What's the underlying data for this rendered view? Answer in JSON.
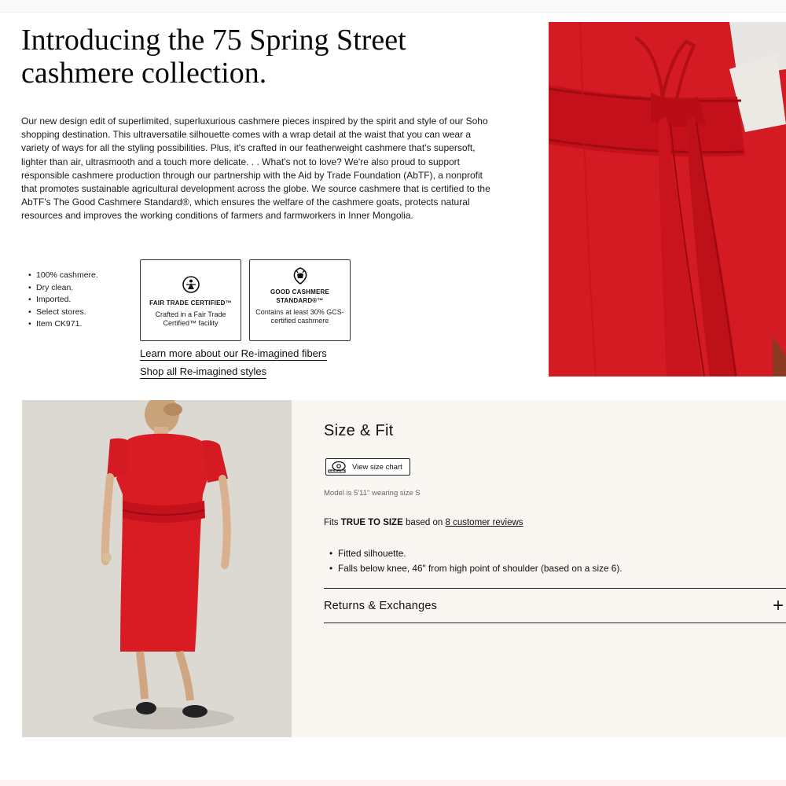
{
  "headline": {
    "line1": "Introducing the 75 Spring Street",
    "line2": "cashmere collection."
  },
  "intro": "Our new design edit of superlimited, superluxurious cashmere pieces inspired by the spirit and style of our Soho shopping destination. This ultraversatile silhouette comes with a wrap detail at the waist that you can wear a variety of ways for all the styling possibilities. Plus, it's crafted in our featherweight cashmere that's supersoft, lighter than air, ultrasmooth and a touch more delicate. . . What's not to love? We're also proud to support responsible cashmere production through our partnership with the Aid by Trade Foundation (AbTF), a nonprofit that promotes sustainable agricultural development across the globe. We source cashmere that is certified to the AbTF's The Good Cashmere Standard®, which ensures the welfare of the cashmere goats, protects natural resources and improves the working conditions of farmers and farmworkers in Inner Mongolia.",
  "specs": [
    "100% cashmere.",
    "Dry clean.",
    "Imported.",
    "Select stores.",
    "Item CK971."
  ],
  "certs": [
    {
      "title": "FAIR TRADE CERTIFIED™",
      "desc": "Crafted in a Fair Trade Certified™ facility",
      "icon": "fair-trade-icon"
    },
    {
      "title": "GOOD CASHMERE STANDARD®™",
      "desc": "Contains at least 30% GCS-certified cashmere",
      "icon": "goat-icon"
    }
  ],
  "links": {
    "fibers": "Learn more about our Re-imagined fibers",
    "styles": "Shop all Re-imagined styles"
  },
  "size_fit": {
    "title": "Size & Fit",
    "size_chart_label": "View size chart",
    "model_note": "Model is 5'11\" wearing size S",
    "fits_prefix": "Fits",
    "fits_value": "TRUE TO SIZE",
    "fits_mid": "based on",
    "reviews_link": "8 customer reviews",
    "bullets": [
      "Fitted silhouette.",
      "Falls below knee, 46\" from high point of shoulder (based on a size 6)."
    ],
    "returns_label": "Returns & Exchanges",
    "expand_symbol": "+"
  },
  "colors": {
    "dress_red": "#d91c24",
    "panel_bg": "#faf6f2"
  }
}
